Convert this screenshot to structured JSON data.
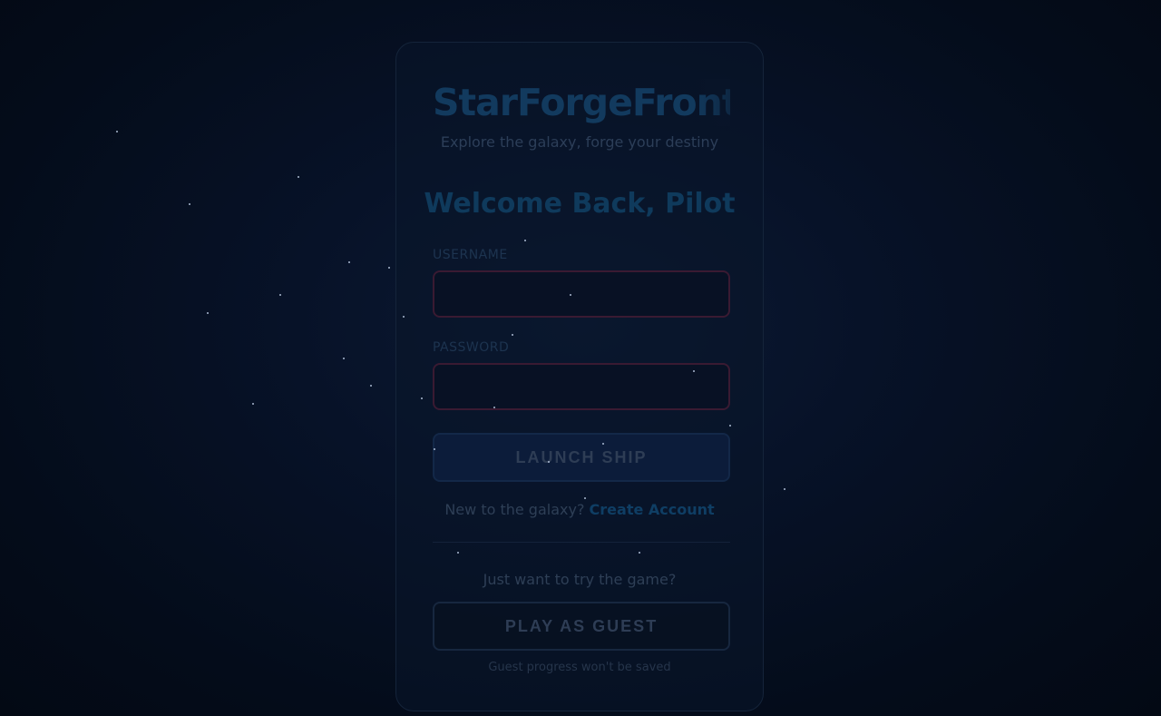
{
  "app": {
    "title": "StarForgeFrontier",
    "tagline": "Explore the galaxy, forge your destiny"
  },
  "login": {
    "heading": "Welcome Back, Pilot",
    "username_label": "USERNAME",
    "username_value": "",
    "password_label": "PASSWORD",
    "password_value": "",
    "submit_label": "LAUNCH SHIP"
  },
  "signup": {
    "prompt": "New to the galaxy?",
    "link_label": "Create Account"
  },
  "guest": {
    "prompt": "Just want to try the game?",
    "button_label": "PLAY AS GUEST",
    "note": "Guest progress won't be saved"
  },
  "colors": {
    "background": "#040c1a",
    "accent": "#0f3a5c",
    "input_border": "#3a1a32",
    "star": "#c8d8f0"
  }
}
